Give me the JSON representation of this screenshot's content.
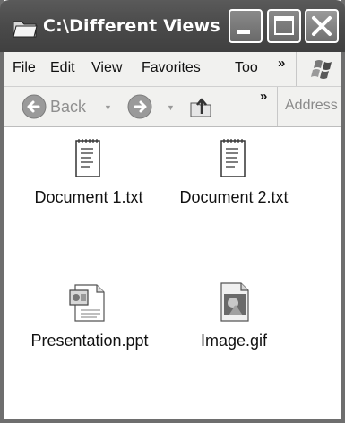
{
  "window": {
    "title": "C:\\Different Views"
  },
  "menu": {
    "items": [
      "File",
      "Edit",
      "View",
      "Favorites",
      "Too"
    ],
    "overflow": "»"
  },
  "toolbar": {
    "back_label": "Back",
    "overflow": "»",
    "address_label": "Address"
  },
  "files": [
    {
      "name": "Document 1.txt",
      "icon": "text-document-icon"
    },
    {
      "name": "Document 2.txt",
      "icon": "text-document-icon"
    },
    {
      "name": "Presentation.ppt",
      "icon": "presentation-icon"
    },
    {
      "name": "Image.gif",
      "icon": "image-icon"
    }
  ],
  "colors": {
    "titlebar": "#4a4a4a",
    "bar_background": "#f1f1ef",
    "frame": "#6e6e6e"
  }
}
